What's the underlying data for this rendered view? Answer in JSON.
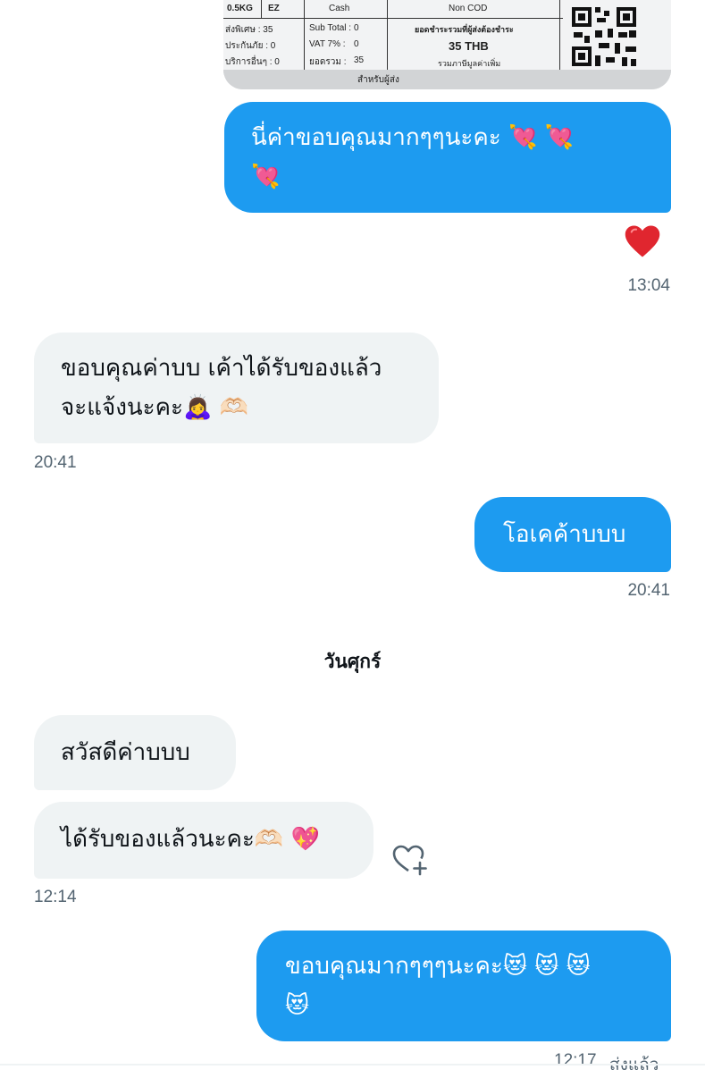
{
  "receipt": {
    "weight": "0.5KG",
    "service": "EZ",
    "payment": "Cash",
    "cod": "Non COD",
    "row1_left": "ส่งพิเศษ : 35",
    "row1_mid_label": "Sub Total :",
    "row1_mid_value": "0",
    "row2_left": "ประกันภัย : 0",
    "row2_mid_label": "VAT 7% :",
    "row2_mid_value": "0",
    "row3_left": "บริการอื่นๆ : 0",
    "row3_mid_label": "ยอดรวม :",
    "row3_mid_value": "35",
    "total_label": "ยอดชำระรวมที่ผู้ส่งต้องชำระ",
    "total_value": "35 THB",
    "vat_note": "รวมภาษีมูลค่าเพิ่ม",
    "footer": "สำหรับผู้ส่ง"
  },
  "messages": [
    {
      "dir": "out",
      "lines": [
        "นี่ค่าขอบคุณมากๆๆนะคะ 💘 💘",
        "💘"
      ]
    },
    {
      "dir": "in",
      "lines": [
        "ขอบคุณค่าบบ เค้าได้รับของแล้ว",
        "จะแจ้งนะคะ🙇‍♀️ 🫶🏻"
      ]
    },
    {
      "dir": "out",
      "lines": [
        "โอเคค้าบบบ"
      ]
    },
    {
      "dir": "in",
      "lines": [
        "สวัสดีค่าบบบ"
      ]
    },
    {
      "dir": "in",
      "lines": [
        "ได้รับของแล้วนะคะ🫶🏻 💖"
      ]
    },
    {
      "dir": "out",
      "lines": [
        "ขอบคุณมากๆๆๆนะคะ😻 😻 😻",
        "😻"
      ]
    }
  ],
  "reaction_emoji": "❤️",
  "timestamps": {
    "t1": "13:04",
    "t2": "20:41",
    "t3": "20:41",
    "t4": "12:14",
    "t5": "12:17",
    "t5_status": "ส่งแล้ว"
  },
  "day_separator": "วันศุกร์",
  "colors": {
    "outgoing_bubble": "#1d9bf0",
    "incoming_bubble": "#eff3f4",
    "timestamp": "#536471"
  },
  "icons": {
    "reaction": "heart-icon",
    "add_reaction": "heart-plus-icon"
  }
}
